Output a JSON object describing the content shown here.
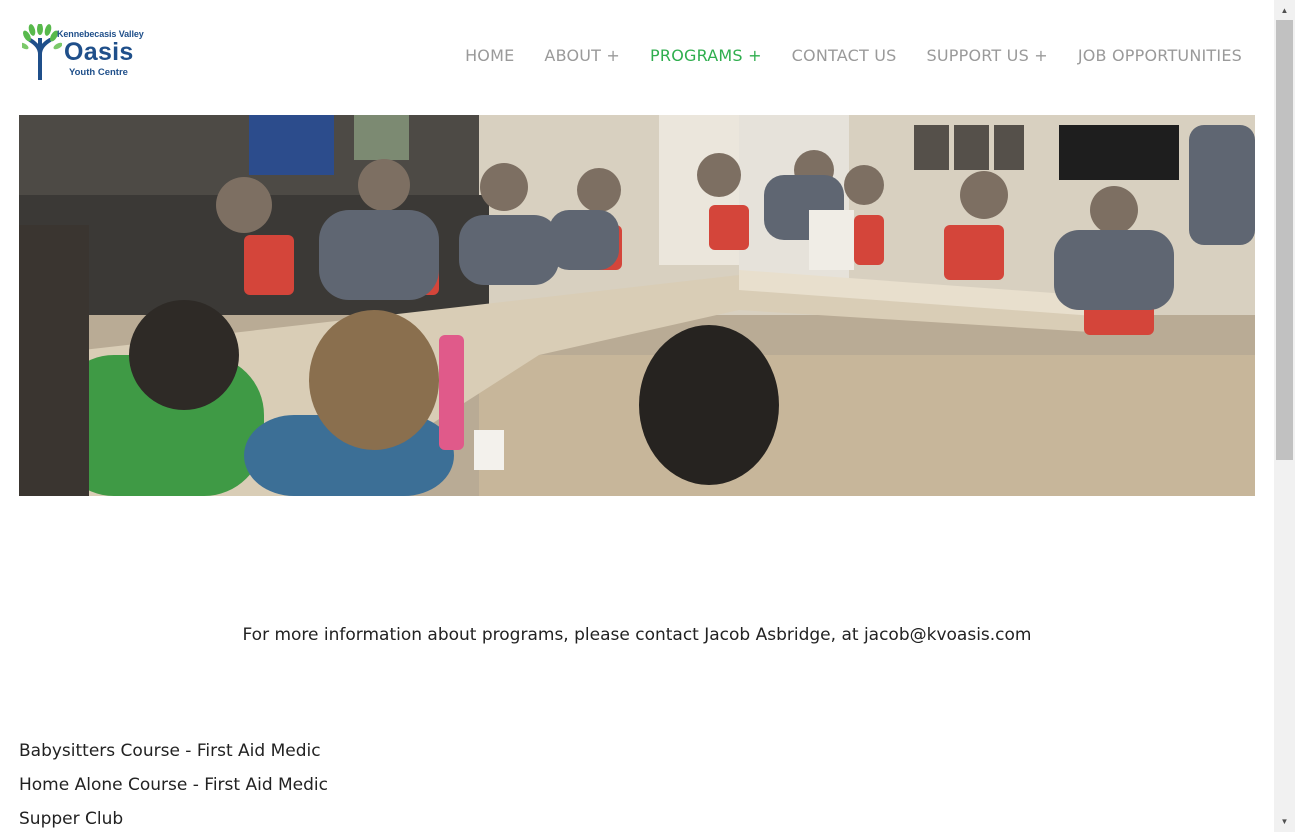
{
  "logo": {
    "top_text": "Kennebecasis Valley",
    "name": "Oasis",
    "subtitle": "Youth Centre",
    "icon": "tree-logo-icon"
  },
  "nav": {
    "items": [
      {
        "label": "HOME",
        "active": false
      },
      {
        "label": "ABOUT +",
        "active": false
      },
      {
        "label": "PROGRAMS +",
        "active": true
      },
      {
        "label": "CONTACT US",
        "active": false
      },
      {
        "label": "SUPPORT US +",
        "active": false
      },
      {
        "label": "JOB OPPORTUNITIES",
        "active": false
      }
    ]
  },
  "colors": {
    "nav_text": "#9a9a9a",
    "nav_active": "#2fae4e",
    "brand_blue": "#1f4f8a",
    "brand_green": "#58b94c"
  },
  "hero": {
    "icon": "group-photo-image"
  },
  "info": {
    "text": "For more information about programs, please contact Jacob Asbridge, at jacob@kvoasis.com"
  },
  "programs": [
    "Babysitters Course - First Aid Medic",
    "Home Alone Course - First Aid Medic",
    "Supper Club"
  ],
  "scrollbar": {
    "up_icon": "arrow-up-icon",
    "down_icon": "arrow-down-icon"
  }
}
